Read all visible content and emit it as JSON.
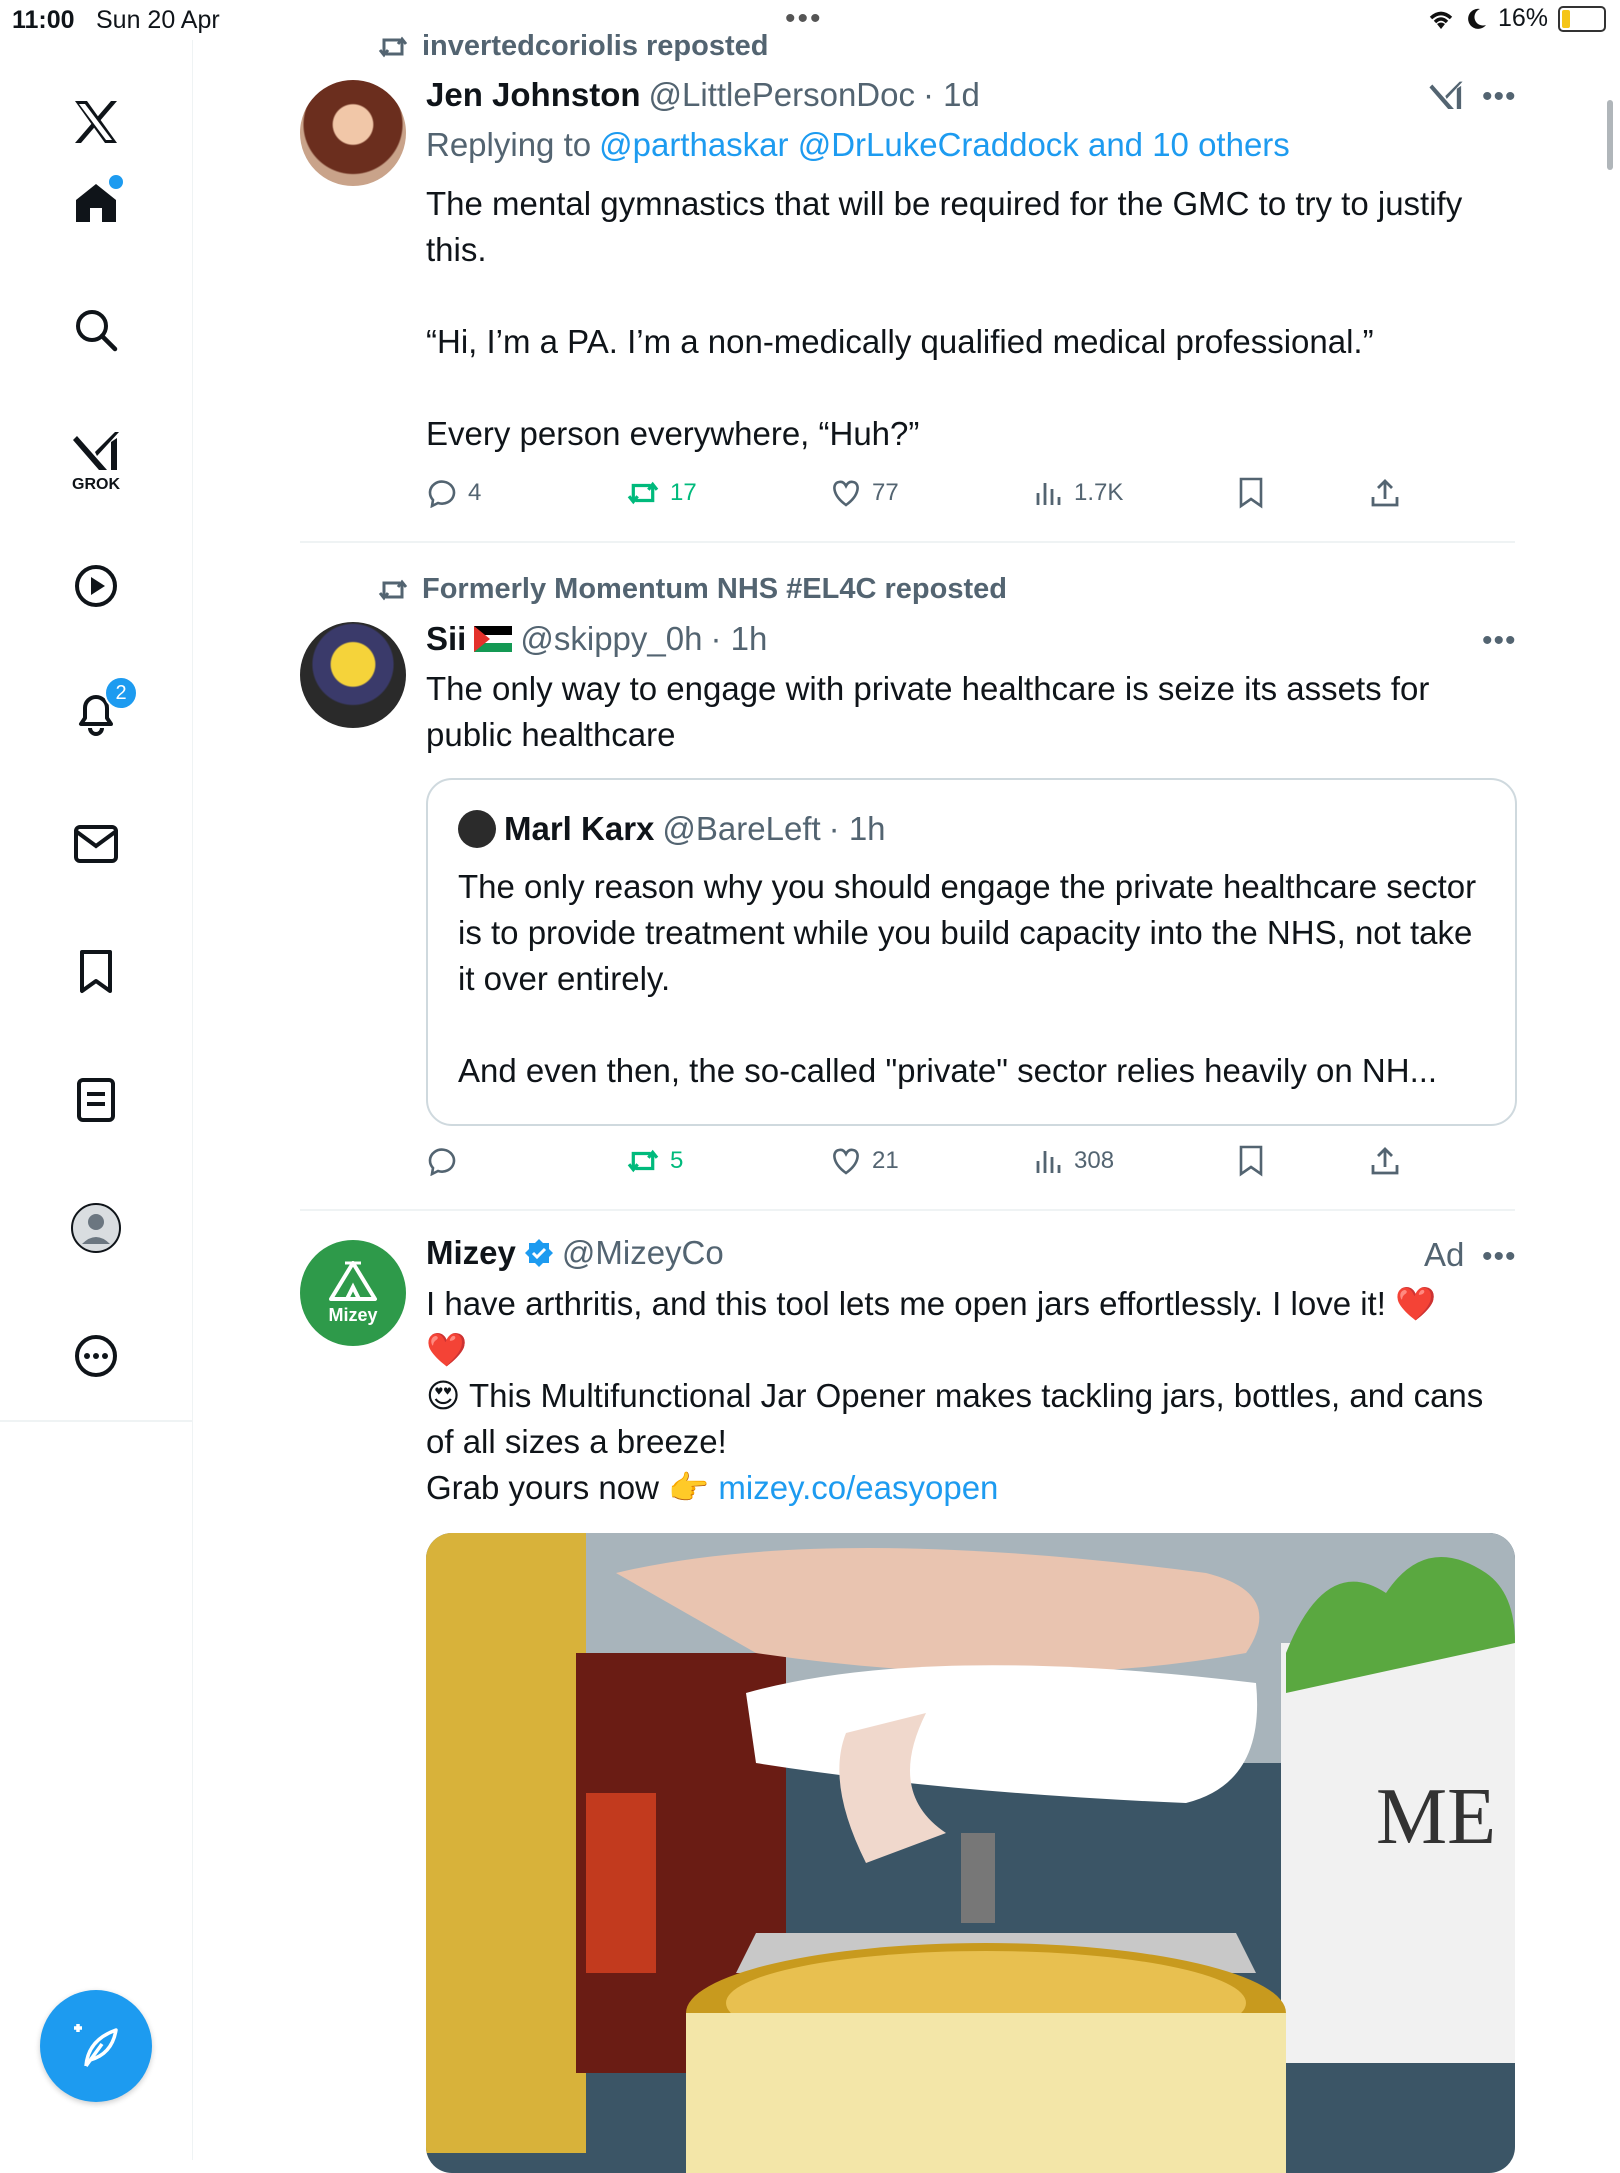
{
  "status_bar": {
    "time": "11:00",
    "date": "Sun 20 Apr",
    "battery": "16%"
  },
  "sidebar": {
    "items": [
      {
        "name": "x-logo"
      },
      {
        "name": "home"
      },
      {
        "name": "search"
      },
      {
        "name": "grok",
        "label": "GROK"
      },
      {
        "name": "videos"
      },
      {
        "name": "notifications",
        "badge": "2"
      },
      {
        "name": "messages"
      },
      {
        "name": "bookmarks"
      },
      {
        "name": "lists"
      },
      {
        "name": "profile"
      },
      {
        "name": "more"
      }
    ],
    "accent": "#1d9bf0"
  },
  "feed": {
    "posts": [
      {
        "reposted_by": "invertedcoriolis reposted",
        "author": "Jen Johnston",
        "handle": "@LittlePersonDoc",
        "time": "· 1d",
        "replying_prefix": "Replying to",
        "replying_users": "@parthaskar @DrLukeCraddock and 10 others",
        "lines": [
          "The mental gymnastics that will be required for the GMC to try to justify this.",
          "“Hi, I’m a PA. I’m a non-medically qualified medical professional.”",
          "Every person everywhere, “Huh?”"
        ],
        "stats": {
          "replies": "4",
          "reposts": "17",
          "likes": "77",
          "views": "1.7K"
        }
      },
      {
        "reposted_by": "Formerly Momentum NHS #EL4C reposted",
        "author": "Sii",
        "handle": "@skippy_0h",
        "time": "· 1h",
        "text": "The only way to engage with private healthcare is seize its assets for public healthcare",
        "quote": {
          "author": "Marl Karx",
          "handle": "@BareLeft",
          "time": "· 1h",
          "para1": "The only reason why you should engage the private healthcare sector is to provide treatment while you build capacity into the NHS, not take it over entirely.",
          "para2": "And even then, the so-called \"private\" sector relies heavily on NH..."
        },
        "stats": {
          "replies": "",
          "reposts": "5",
          "likes": "21",
          "views": "308"
        }
      },
      {
        "author": "Mizey",
        "handle": "@MizeyCo",
        "ad_label": "Ad",
        "avatar_text": "Mizey",
        "line1": "I have arthritis, and this tool lets me open jars effortlessly. I love it! ❤️",
        "line2": "❤️",
        "line3": "😍 This Multifunctional Jar Opener makes tackling jars, bottles, and cans of all sizes a breeze!",
        "line4_prefix": "Grab yours now 👉",
        "link": "mizey.co/easyopen",
        "image_text": "ME"
      }
    ]
  }
}
